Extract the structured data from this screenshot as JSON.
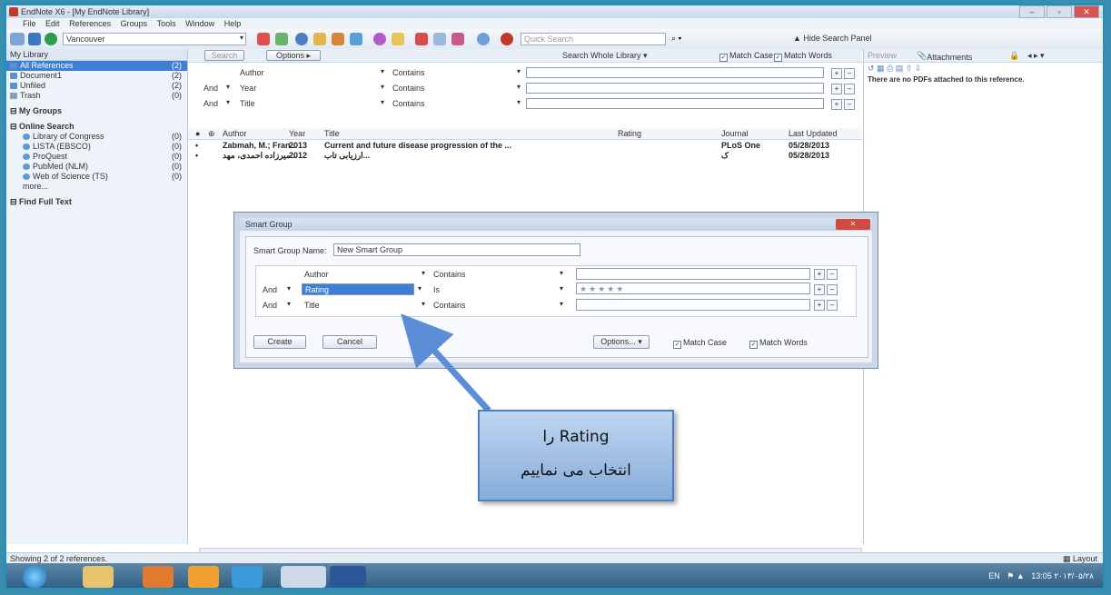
{
  "window": {
    "title": "EndNote X6 - [My EndNote Library]"
  },
  "menu": [
    "File",
    "Edit",
    "References",
    "Groups",
    "Tools",
    "Window",
    "Help"
  ],
  "toolbar": {
    "style": "Vancouver",
    "quick_search": "Quick Search",
    "hide_search": "Hide Search Panel"
  },
  "sidebar": {
    "header": "My Library",
    "library_items": [
      {
        "label": "All References",
        "count": "(2)"
      },
      {
        "label": "Document1",
        "count": "(2)"
      },
      {
        "label": "Unfiled",
        "count": "(2)"
      },
      {
        "label": "Trash",
        "count": "(0)"
      }
    ],
    "my_groups": "My Groups",
    "online_search": "Online Search",
    "online_items": [
      {
        "label": "Library of Congress",
        "count": "(0)"
      },
      {
        "label": "LISTA (EBSCO)",
        "count": "(0)"
      },
      {
        "label": "ProQuest",
        "count": "(0)"
      },
      {
        "label": "PubMed (NLM)",
        "count": "(0)"
      },
      {
        "label": "Web of Science (TS)",
        "count": "(0)"
      }
    ],
    "more": "more...",
    "find_full_text": "Find Full Text"
  },
  "search_panel": {
    "search_btn": "Search",
    "options_btn": "Options ▸",
    "scope": "Search Whole Library",
    "match_case": "Match Case",
    "match_words": "Match Words",
    "rows": [
      {
        "bool": "",
        "field": "Author",
        "op": "Contains"
      },
      {
        "bool": "And",
        "field": "Year",
        "op": "Contains"
      },
      {
        "bool": "And",
        "field": "Title",
        "op": "Contains"
      }
    ]
  },
  "reference_list": {
    "columns": [
      "Author",
      "Year",
      "Title",
      "Rating",
      "Journal",
      "Last Updated"
    ],
    "rows": [
      {
        "author": "Zabmah, M.; Fran...",
        "year": "2013",
        "title": "Current and future disease progression of the ...",
        "rating": "",
        "journal": "PLoS One",
        "updated": "05/28/2013"
      },
      {
        "author": "میرزاده احمدی، مهد...",
        "year": "2012",
        "title": "ارزیابی تاب...",
        "rating": "",
        "journal": "ک",
        "updated": "05/28/2013"
      }
    ]
  },
  "right_panel": {
    "tabs": [
      "Preview",
      "Attachments"
    ],
    "message": "There are no PDFs attached to this reference."
  },
  "status": {
    "text": "Showing 2 of 2 references.",
    "layout": "Layout"
  },
  "taskbar": {
    "clock_time": "13:05",
    "clock_date": "۲۰۱۳/۰۵/۲۸",
    "lang": "EN"
  },
  "dialog": {
    "title": "Smart Group",
    "name_label": "Smart Group Name:",
    "name_value": "New Smart Group",
    "rows": [
      {
        "bool": "",
        "field": "Author",
        "op": "Contains",
        "value": ""
      },
      {
        "bool": "And",
        "field": "Rating",
        "op": "Is",
        "value": "★★★★★"
      },
      {
        "bool": "And",
        "field": "Title",
        "op": "Contains",
        "value": ""
      }
    ],
    "create": "Create",
    "cancel": "Cancel",
    "options": "Options... ▾",
    "match_case": "Match Case",
    "match_words": "Match Words"
  },
  "callout": {
    "line1": "Rating را",
    "line2": "انتخاب می نماییم"
  }
}
